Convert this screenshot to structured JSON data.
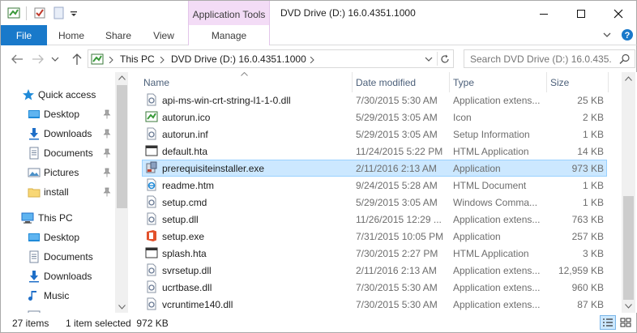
{
  "titlebar": {
    "context_tab_label": "Application Tools",
    "window_title": "DVD Drive (D:) 16.0.4351.1000"
  },
  "ribbon": {
    "tabs": [
      "File",
      "Home",
      "Share",
      "View",
      "Manage"
    ]
  },
  "address": {
    "crumbs": [
      "This PC",
      "DVD Drive (D:) 16.0.4351.1000"
    ],
    "search_placeholder": "Search DVD Drive (D:) 16.0.435..."
  },
  "navpane": {
    "items": [
      {
        "label": "Quick access",
        "icon": "star-icon",
        "pinned": false
      },
      {
        "label": "Desktop",
        "icon": "desktop-folder-icon",
        "pinned": true
      },
      {
        "label": "Downloads",
        "icon": "downloads-folder-icon",
        "pinned": true
      },
      {
        "label": "Documents",
        "icon": "documents-folder-icon",
        "pinned": true
      },
      {
        "label": "Pictures",
        "icon": "pictures-folder-icon",
        "pinned": true
      },
      {
        "label": "install",
        "icon": "folder-icon",
        "pinned": true
      },
      {
        "label": "This PC",
        "icon": "computer-icon",
        "pinned": false
      },
      {
        "label": "Desktop",
        "icon": "desktop-folder-icon",
        "pinned": false
      },
      {
        "label": "Documents",
        "icon": "documents-folder-icon",
        "pinned": false
      },
      {
        "label": "Downloads",
        "icon": "downloads-folder-icon",
        "pinned": false
      },
      {
        "label": "Music",
        "icon": "music-folder-icon",
        "pinned": false
      }
    ]
  },
  "filelist": {
    "columns": {
      "name": "Name",
      "date": "Date modified",
      "type": "Type",
      "size": "Size"
    },
    "rows": [
      {
        "name": "api-ms-win-crt-string-l1-1-0.dll",
        "date": "7/30/2015 5:30 AM",
        "type": "Application extens...",
        "size": "25 KB",
        "icon": "dll-icon"
      },
      {
        "name": "autorun.ico",
        "date": "5/29/2015 3:05 AM",
        "type": "Icon",
        "size": "2 KB",
        "icon": "ico-icon"
      },
      {
        "name": "autorun.inf",
        "date": "5/29/2015 3:05 AM",
        "type": "Setup Information",
        "size": "1 KB",
        "icon": "inf-icon"
      },
      {
        "name": "default.hta",
        "date": "11/24/2015 5:22 PM",
        "type": "HTML Application",
        "size": "14 KB",
        "icon": "hta-icon"
      },
      {
        "name": "prerequisiteinstaller.exe",
        "date": "2/11/2016 2:13 AM",
        "type": "Application",
        "size": "973 KB",
        "icon": "installer-exe-icon",
        "selected": true
      },
      {
        "name": "readme.htm",
        "date": "9/24/2015 5:28 AM",
        "type": "HTML Document",
        "size": "1 KB",
        "icon": "ie-document-icon"
      },
      {
        "name": "setup.cmd",
        "date": "5/29/2015 3:05 AM",
        "type": "Windows Comma...",
        "size": "1 KB",
        "icon": "cmd-icon"
      },
      {
        "name": "setup.dll",
        "date": "11/26/2015 12:29 ...",
        "type": "Application extens...",
        "size": "763 KB",
        "icon": "dll-icon"
      },
      {
        "name": "setup.exe",
        "date": "7/31/2015 10:05 PM",
        "type": "Application",
        "size": "257 KB",
        "icon": "office-exe-icon"
      },
      {
        "name": "splash.hta",
        "date": "7/30/2015 2:27 PM",
        "type": "HTML Application",
        "size": "3 KB",
        "icon": "hta-icon"
      },
      {
        "name": "svrsetup.dll",
        "date": "2/11/2016 2:13 AM",
        "type": "Application extens...",
        "size": "12,959 KB",
        "icon": "dll-icon"
      },
      {
        "name": "ucrtbase.dll",
        "date": "7/30/2015 5:30 AM",
        "type": "Application extens...",
        "size": "960 KB",
        "icon": "dll-icon"
      },
      {
        "name": "vcruntime140.dll",
        "date": "7/30/2015 5:30 AM",
        "type": "Application extens...",
        "size": "87 KB",
        "icon": "dll-icon"
      }
    ]
  },
  "status": {
    "item_count": "27 items",
    "selection": "1 item selected  972 KB"
  },
  "colors": {
    "file_tab": "#1979ca",
    "context_tab": "#f3dcf6",
    "selection_bg": "#cce8ff",
    "selection_border": "#99d1ff",
    "column_header_text": "#4c607a"
  }
}
